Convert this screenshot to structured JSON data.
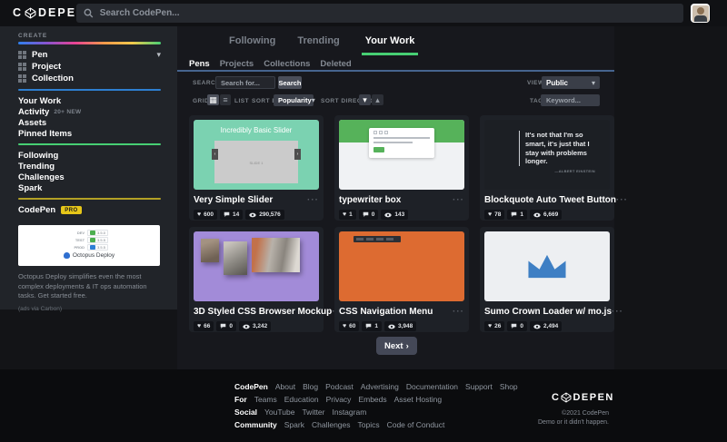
{
  "header": {
    "logo_left": "C",
    "logo_right": "DEPEN",
    "search_placeholder": "Search CodePen..."
  },
  "icons": {
    "chevron_down": "▾",
    "chevron_up": "▴",
    "dots": "···",
    "grid": "▦",
    "list": "≡",
    "next_chevron": "›",
    "heart": "♥",
    "arrow_left": "‹",
    "arrow_right": "›"
  },
  "sidebar": {
    "create_label": "CREATE",
    "create_items": [
      {
        "label": "Pen"
      },
      {
        "label": "Project"
      },
      {
        "label": "Collection"
      }
    ],
    "nav1": [
      {
        "label": "Your Work"
      },
      {
        "label": "Activity",
        "badge": "20+ NEW"
      },
      {
        "label": "Assets"
      },
      {
        "label": "Pinned Items"
      }
    ],
    "nav2": [
      {
        "label": "Following"
      },
      {
        "label": "Trending"
      },
      {
        "label": "Challenges"
      },
      {
        "label": "Spark"
      }
    ],
    "pro_label": "CodePen",
    "pro_badge": "PRO",
    "ad": {
      "rows": [
        {
          "env": "DEV",
          "ver": "3.5.0"
        },
        {
          "env": "TEST",
          "ver": "3.5.5"
        },
        {
          "env": "PROD",
          "ver": "3.5.5"
        }
      ],
      "brand": "Octopus Deploy",
      "text": "Octopus Deploy simplifies even the most complex deployments & IT ops automation tasks. Get started free.",
      "via": "(ads via Carbon)"
    }
  },
  "main": {
    "tabs": [
      {
        "label": "Following"
      },
      {
        "label": "Trending"
      },
      {
        "label": "Your Work"
      }
    ],
    "subtabs": [
      {
        "label": "Pens"
      },
      {
        "label": "Projects"
      },
      {
        "label": "Collections"
      },
      {
        "label": "Deleted"
      }
    ],
    "filters": {
      "search_label": "SEARCH",
      "search_placeholder": "Search for...",
      "search_button": "Search",
      "view_label": "VIEW",
      "view_value": "Public",
      "grid_label": "GRID",
      "list_label": "LIST",
      "sort_by_label": "SORT BY",
      "sort_by_value": "Popularity",
      "sort_direction_label": "SORT DIRECTION",
      "tag_label": "TAG",
      "tag_placeholder": "Keyword..."
    },
    "cards": [
      {
        "title": "Very Simple Slider",
        "loves": "600",
        "comments": "14",
        "views": "290,576",
        "preview": {
          "heading": "Incredibly Basic Slider",
          "slide_label": "SLIDE 1"
        }
      },
      {
        "title": "typewriter box",
        "loves": "1",
        "comments": "0",
        "views": "143"
      },
      {
        "title": "Blockquote Auto Tweet Button",
        "loves": "78",
        "comments": "1",
        "views": "6,669",
        "preview": {
          "quote": "It's not that I'm so smart, it's just that I stay with problems longer.",
          "attribution": "—ALBERT EINSTEIN"
        }
      },
      {
        "title": "3D Styled CSS Browser Mockup",
        "loves": "66",
        "comments": "0",
        "views": "3,242"
      },
      {
        "title": "CSS Navigation Menu",
        "loves": "60",
        "comments": "1",
        "views": "3,948"
      },
      {
        "title": "Sumo Crown Loader w/ mo.js",
        "loves": "26",
        "comments": "0",
        "views": "2,494"
      }
    ],
    "pagination_next": "Next"
  },
  "footer": {
    "groups": [
      {
        "title": "CodePen",
        "links": [
          "About",
          "Blog",
          "Podcast",
          "Advertising",
          "Documentation",
          "Support",
          "Shop"
        ]
      },
      {
        "title": "For",
        "links": [
          "Teams",
          "Education",
          "Privacy",
          "Embeds",
          "Asset Hosting"
        ]
      },
      {
        "title": "Social",
        "links": [
          "YouTube",
          "Twitter",
          "Instagram"
        ]
      },
      {
        "title": "Community",
        "links": [
          "Spark",
          "Challenges",
          "Topics",
          "Code of Conduct"
        ]
      }
    ],
    "logo_left": "C",
    "logo_right": "DEPEN",
    "copyright": "©2021 CodePen",
    "tagline": "Demo or it didn't happen."
  },
  "colors": {
    "accent_green": "#47cf73",
    "pro_yellow": "#e6c619",
    "preview_teal": "#7bd2b1",
    "preview_green": "#56b25a",
    "preview_purple": "#a28bd8",
    "preview_orange": "#dd6b31",
    "crown_blue": "#3e7fc4"
  }
}
